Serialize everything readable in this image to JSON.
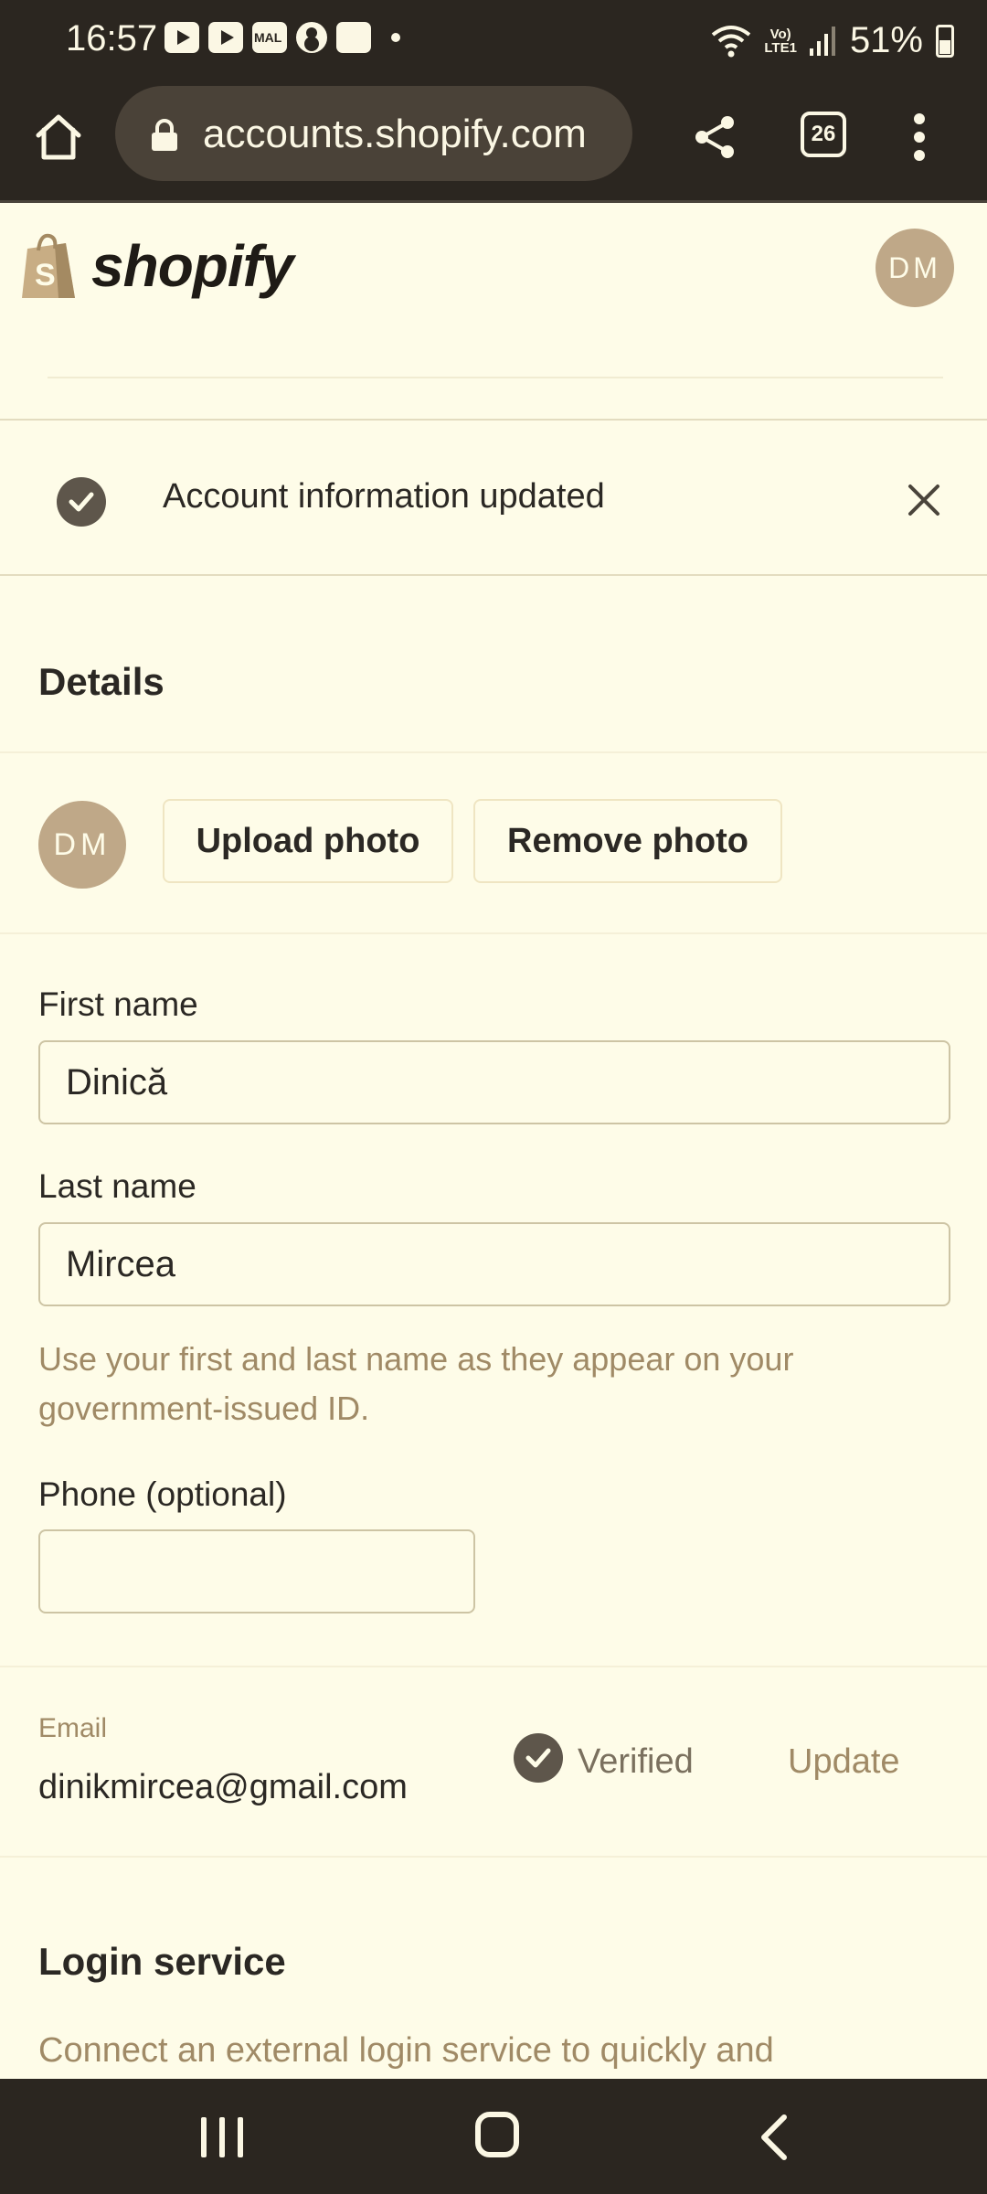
{
  "status": {
    "time": "16:57",
    "mal_label": "MAL",
    "volte_top": "Vo)",
    "volte_bottom": "LTE1",
    "battery": "51%"
  },
  "browser": {
    "url": "accounts.shopify.com",
    "tab_count": "26"
  },
  "header": {
    "brand": "shopify",
    "avatar_initials": "DM"
  },
  "banner": {
    "message": "Account information updated"
  },
  "details": {
    "title": "Details",
    "avatar_initials": "DM",
    "upload_label": "Upload photo",
    "remove_label": "Remove photo",
    "first_name_label": "First name",
    "first_name_value": "Dinică",
    "last_name_label": "Last name",
    "last_name_value": "Mircea",
    "name_help": "Use your first and last name as they appear on your government-issued ID.",
    "phone_label": "Phone (optional)",
    "phone_value": ""
  },
  "email": {
    "caption": "Email",
    "value": "dinikmircea@gmail.com",
    "status": "Verified",
    "update_label": "Update"
  },
  "login_service": {
    "title": "Login service",
    "description": "Connect an external login service to quickly and"
  }
}
